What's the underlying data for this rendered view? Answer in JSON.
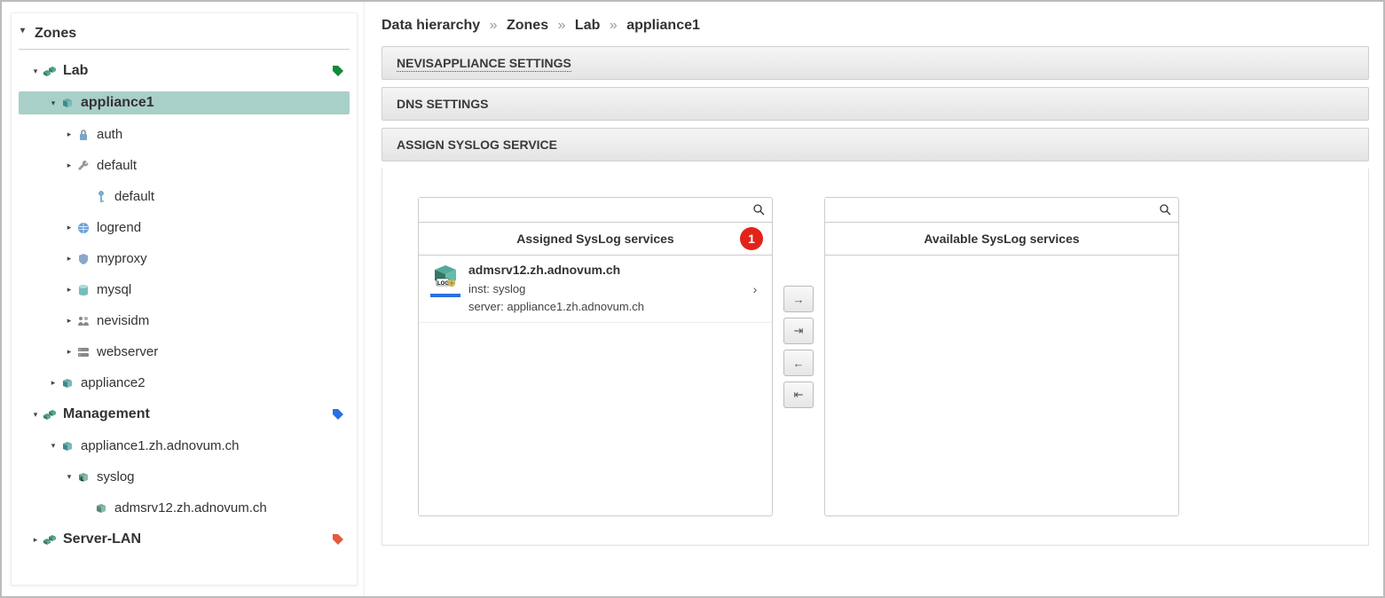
{
  "sidebar": {
    "header": "Zones",
    "lab": {
      "label": "Lab"
    },
    "appliance1": {
      "label": "appliance1"
    },
    "auth": {
      "label": "auth"
    },
    "defaultA": {
      "label": "default"
    },
    "defaultB": {
      "label": "default"
    },
    "logrend": {
      "label": "logrend"
    },
    "myproxy": {
      "label": "myproxy"
    },
    "mysql": {
      "label": "mysql"
    },
    "nevisidm": {
      "label": "nevisidm"
    },
    "webserver": {
      "label": "webserver"
    },
    "appliance2": {
      "label": "appliance2"
    },
    "management": {
      "label": "Management"
    },
    "appliance1zh": {
      "label": "appliance1.zh.adnovum.ch"
    },
    "syslog": {
      "label": "syslog"
    },
    "admsrv12": {
      "label": "admsrv12.zh.adnovum.ch"
    },
    "serverlan": {
      "label": "Server-LAN"
    }
  },
  "breadcrumb": {
    "root": "Data hierarchy",
    "zones": "Zones",
    "lab": "Lab",
    "leaf": "appliance1"
  },
  "panels": {
    "nevis": "NEVISAPPLIANCE SETTINGS",
    "dns": "DNS SETTINGS",
    "syslog": "ASSIGN SYSLOG SERVICE"
  },
  "assigned": {
    "header": "Assigned SysLog services",
    "badge": "1",
    "item": {
      "title": "admsrv12.zh.adnovum.ch",
      "inst": "inst: syslog",
      "server": "server: appliance1.zh.adnovum.ch"
    }
  },
  "available": {
    "header": "Available SysLog services"
  }
}
